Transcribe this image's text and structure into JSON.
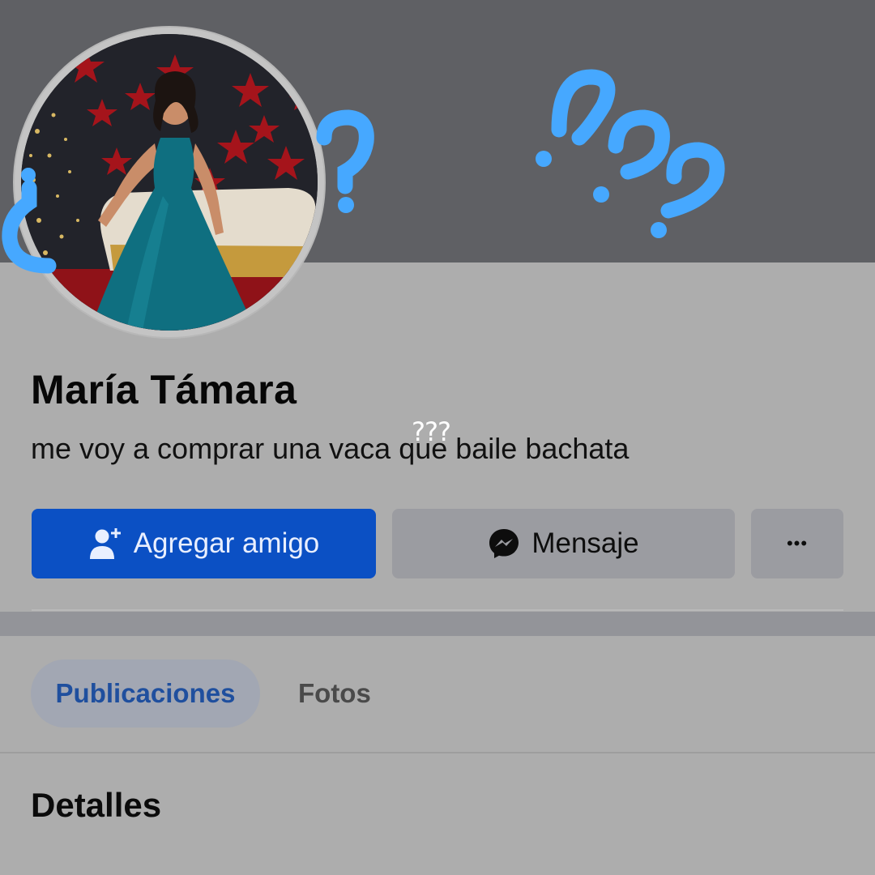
{
  "profile": {
    "name": "María Támara",
    "bio": "me voy a comprar una vaca que baile bachata",
    "bio_overlay": "???"
  },
  "actions": {
    "add_friend_label": "Agregar amigo",
    "message_label": "Mensaje",
    "more_label": "•••"
  },
  "tabs": [
    {
      "label": "Publicaciones",
      "selected": true
    },
    {
      "label": "Fotos",
      "selected": false
    }
  ],
  "sections": {
    "details_title": "Detalles"
  },
  "icons": {
    "add_friend": "add-friend-icon",
    "messenger": "messenger-icon",
    "more": "more-dots-icon"
  },
  "colors": {
    "primary_button": "#0b50c4",
    "secondary_button": "#9b9ca1",
    "selected_tab_text": "#1f4f9e",
    "question_marks": "#46a8ff",
    "cover": "#5f6064",
    "background": "#adadad"
  }
}
